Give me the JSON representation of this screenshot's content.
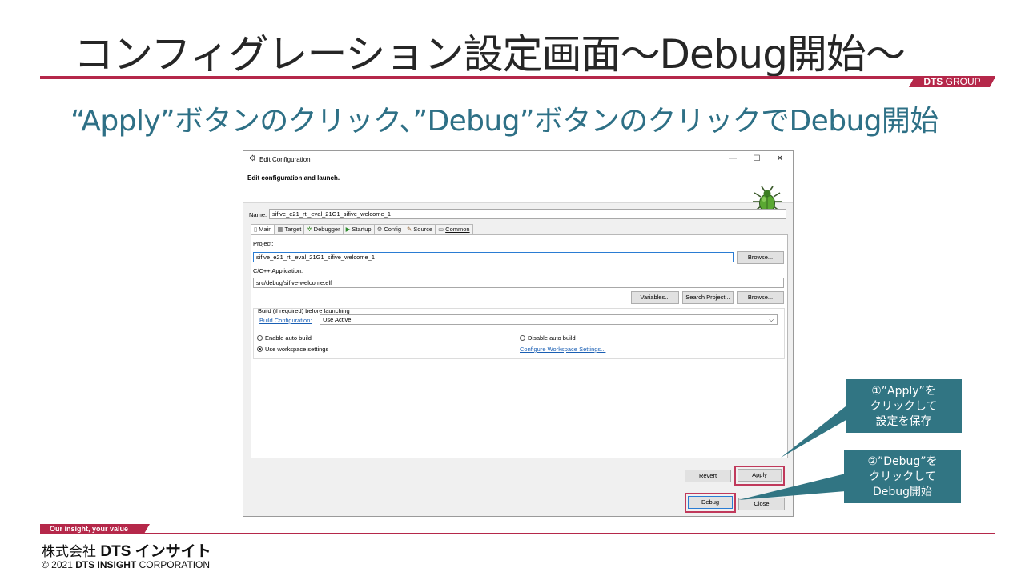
{
  "slide": {
    "title": "コンフィグレーション設定画面～Debug開始～",
    "subtitle": "“Apply”ボタンのクリック、”Debug”ボタンのクリックでDebug開始",
    "brand_tag": "GROUP",
    "brand_tag_bold": "DTS",
    "footer_tag": "Our insight, your value",
    "company_prefix": "株式会社",
    "company_name": "DTS インサイト",
    "copyright_prefix": "© 2021",
    "copyright_bold": "DTS INSIGHT",
    "copyright_suffix": "CORPORATION",
    "accent_color": "#b5284a",
    "subtitle_color": "#2e7086"
  },
  "dialog": {
    "window_title": "Edit Configuration",
    "header": "Edit configuration and launch.",
    "name_label": "Name:",
    "name_value": "sifive_e21_rtl_eval_21G1_sifive_welcome_1",
    "tabs": [
      {
        "label": "Main",
        "icon": "document-icon"
      },
      {
        "label": "Target",
        "icon": "chip-icon"
      },
      {
        "label": "Debugger",
        "icon": "debugger-icon"
      },
      {
        "label": "Startup",
        "icon": "play-icon"
      },
      {
        "label": "Config",
        "icon": "gear-icon"
      },
      {
        "label": "Source",
        "icon": "source-icon"
      },
      {
        "label": "Common",
        "icon": "window-icon"
      }
    ],
    "project_label": "Project:",
    "project_value": "sifive_e21_rtl_eval_21G1_sifive_welcome_1",
    "browse_label": "Browse...",
    "app_label": "C/C++ Application:",
    "app_value": "src/debug/sifive-welcome.elf",
    "variables_label": "Variables...",
    "search_project_label": "Search Project...",
    "browse2_label": "Browse...",
    "build_group_label": "Build (if required) before launching",
    "build_config_link": "Build Configuration:",
    "build_config_value": "Use Active",
    "enable_auto_build": "Enable auto build",
    "disable_auto_build": "Disable auto build",
    "use_workspace_settings": "Use workspace settings",
    "configure_workspace_link": "Configure Workspace Settings...",
    "revert_label": "Revert",
    "apply_label": "Apply",
    "debug_label": "Debug",
    "close_label": "Close"
  },
  "callouts": {
    "apply": [
      "①”Apply”を",
      "クリックして",
      "設定を保存"
    ],
    "debug": [
      "②”Debug”を",
      "クリックして",
      "Debug開始"
    ],
    "color": "#317583"
  }
}
